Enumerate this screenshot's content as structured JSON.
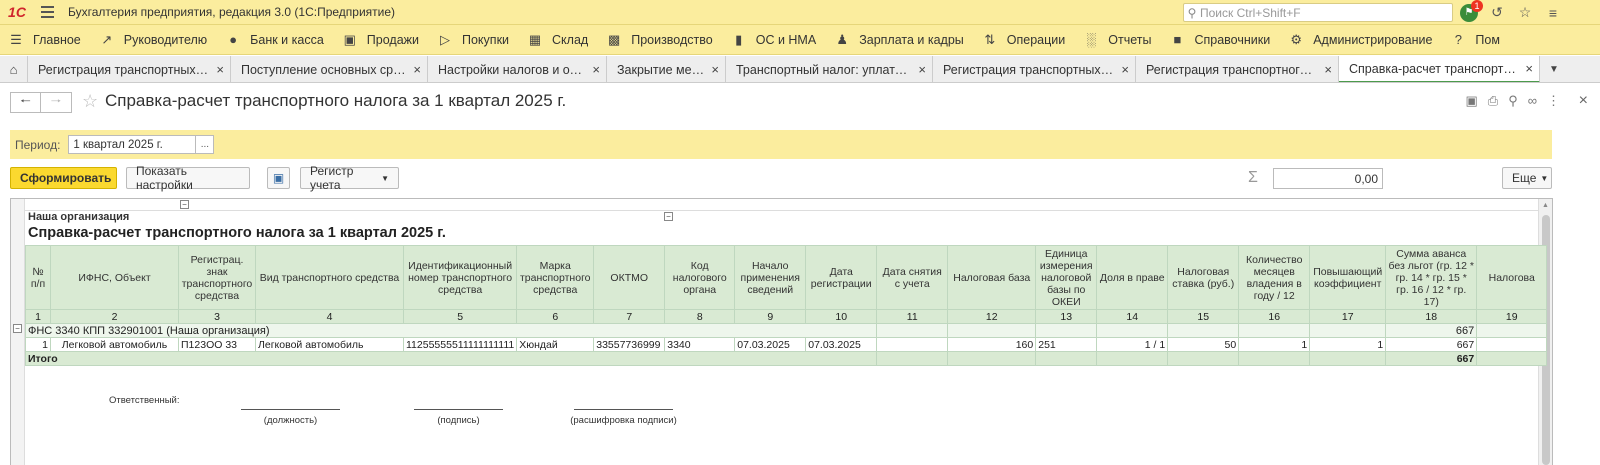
{
  "app": {
    "logo": "1С",
    "title": "Бухгалтерия предприятия, редакция 3.0  (1С:Предприятие)",
    "search_placeholder": "Поиск Ctrl+Shift+F",
    "notifications_count": "1"
  },
  "sections": [
    {
      "label": "Главное",
      "icon": "menu-lines-icon"
    },
    {
      "label": "Руководителю",
      "icon": "trend-icon"
    },
    {
      "label": "Банк и касса",
      "icon": "coin-icon"
    },
    {
      "label": "Продажи",
      "icon": "bag-icon"
    },
    {
      "label": "Покупки",
      "icon": "cart-icon"
    },
    {
      "label": "Склад",
      "icon": "warehouse-icon"
    },
    {
      "label": "Производство",
      "icon": "factory-icon"
    },
    {
      "label": "ОС и НМА",
      "icon": "truck-icon"
    },
    {
      "label": "Зарплата и кадры",
      "icon": "person-icon"
    },
    {
      "label": "Операции",
      "icon": "dt-kt-icon"
    },
    {
      "label": "Отчеты",
      "icon": "bar-chart-icon"
    },
    {
      "label": "Справочники",
      "icon": "book-icon"
    },
    {
      "label": "Администрирование",
      "icon": "gear-icon"
    },
    {
      "label": "Пом",
      "icon": "question-icon"
    }
  ],
  "tabs": [
    {
      "label": "Регистрация транспортных сре..."
    },
    {
      "label": "Поступление основных средств"
    },
    {
      "label": "Настройки налогов и отчетов"
    },
    {
      "label": "Закрытие месяца"
    },
    {
      "label": "Транспортный налог: уплата а..."
    },
    {
      "label": "Регистрация транспортных сре..."
    },
    {
      "label": "Регистрация транспортного ср..."
    },
    {
      "label": "Справка-расчет транспортного..."
    }
  ],
  "form": {
    "title": "Справка-расчет транспортного налога за 1 квартал 2025 г.",
    "period_label": "Период:",
    "period_value": "1 квартал 2025 г.",
    "period_pick": "...",
    "generate_label": "Сформировать",
    "show_settings_label": "Показать настройки",
    "register_label": "Регистр учета",
    "sum_value": "0,00",
    "more_label": "Еще"
  },
  "report": {
    "organization": "Наша организация",
    "title": "Справка-расчет транспортного налога за 1 квартал 2025 г.",
    "headers": [
      "№ п/п",
      "ИФНС, Объект",
      "Регистрац. знак транспортного средства",
      "Вид транспортного средства",
      "Идентификационный номер транспортного средства",
      "Марка транспортного средства",
      "ОКТМО",
      "Код налогового органа",
      "Начало применения сведений",
      "Дата регистрации",
      "Дата снятия с учета",
      "Налоговая база",
      "Единица измерения налоговой базы по ОКЕИ",
      "Доля в праве",
      "Налоговая ставка (руб.)",
      "Количество месяцев владения в году / 12",
      "Повышающий коэффициент",
      "Сумма аванса без льгот (гр. 12 * гр. 14 * гр. 15 * гр. 16 / 12 * гр. 17)",
      "Налогова"
    ],
    "col_numbers": [
      "1",
      "2",
      "3",
      "4",
      "5",
      "6",
      "7",
      "8",
      "9",
      "10",
      "11",
      "12",
      "13",
      "14",
      "15",
      "16",
      "17",
      "18",
      "19"
    ],
    "group_row": {
      "label": "ФНС 3340 КПП 332901001 (Наша организация)",
      "sum": "667"
    },
    "rows": [
      {
        "n": "1",
        "object": "Легковой автомобиль",
        "reg_sign": "П123ОО 33",
        "type": "Легковой автомобиль",
        "vin": "11255555511111111111",
        "brand": "Хюндай",
        "oktmo": "33557736999",
        "tax_code": "3340",
        "start_date": "07.03.2025",
        "reg_date": "07.03.2025",
        "dereg_date": "",
        "tax_base": "160",
        "unit": "251",
        "share": "1 / 1",
        "rate": "50",
        "months": "1",
        "coef": "1",
        "advance": "667",
        "tax": ""
      }
    ],
    "total_label": "Итого",
    "total_sum": "667",
    "signature": {
      "responsible": "Ответственный:",
      "position": "(должность)",
      "sign": "(подпись)",
      "decoding": "(расшифровка подписи)"
    }
  }
}
